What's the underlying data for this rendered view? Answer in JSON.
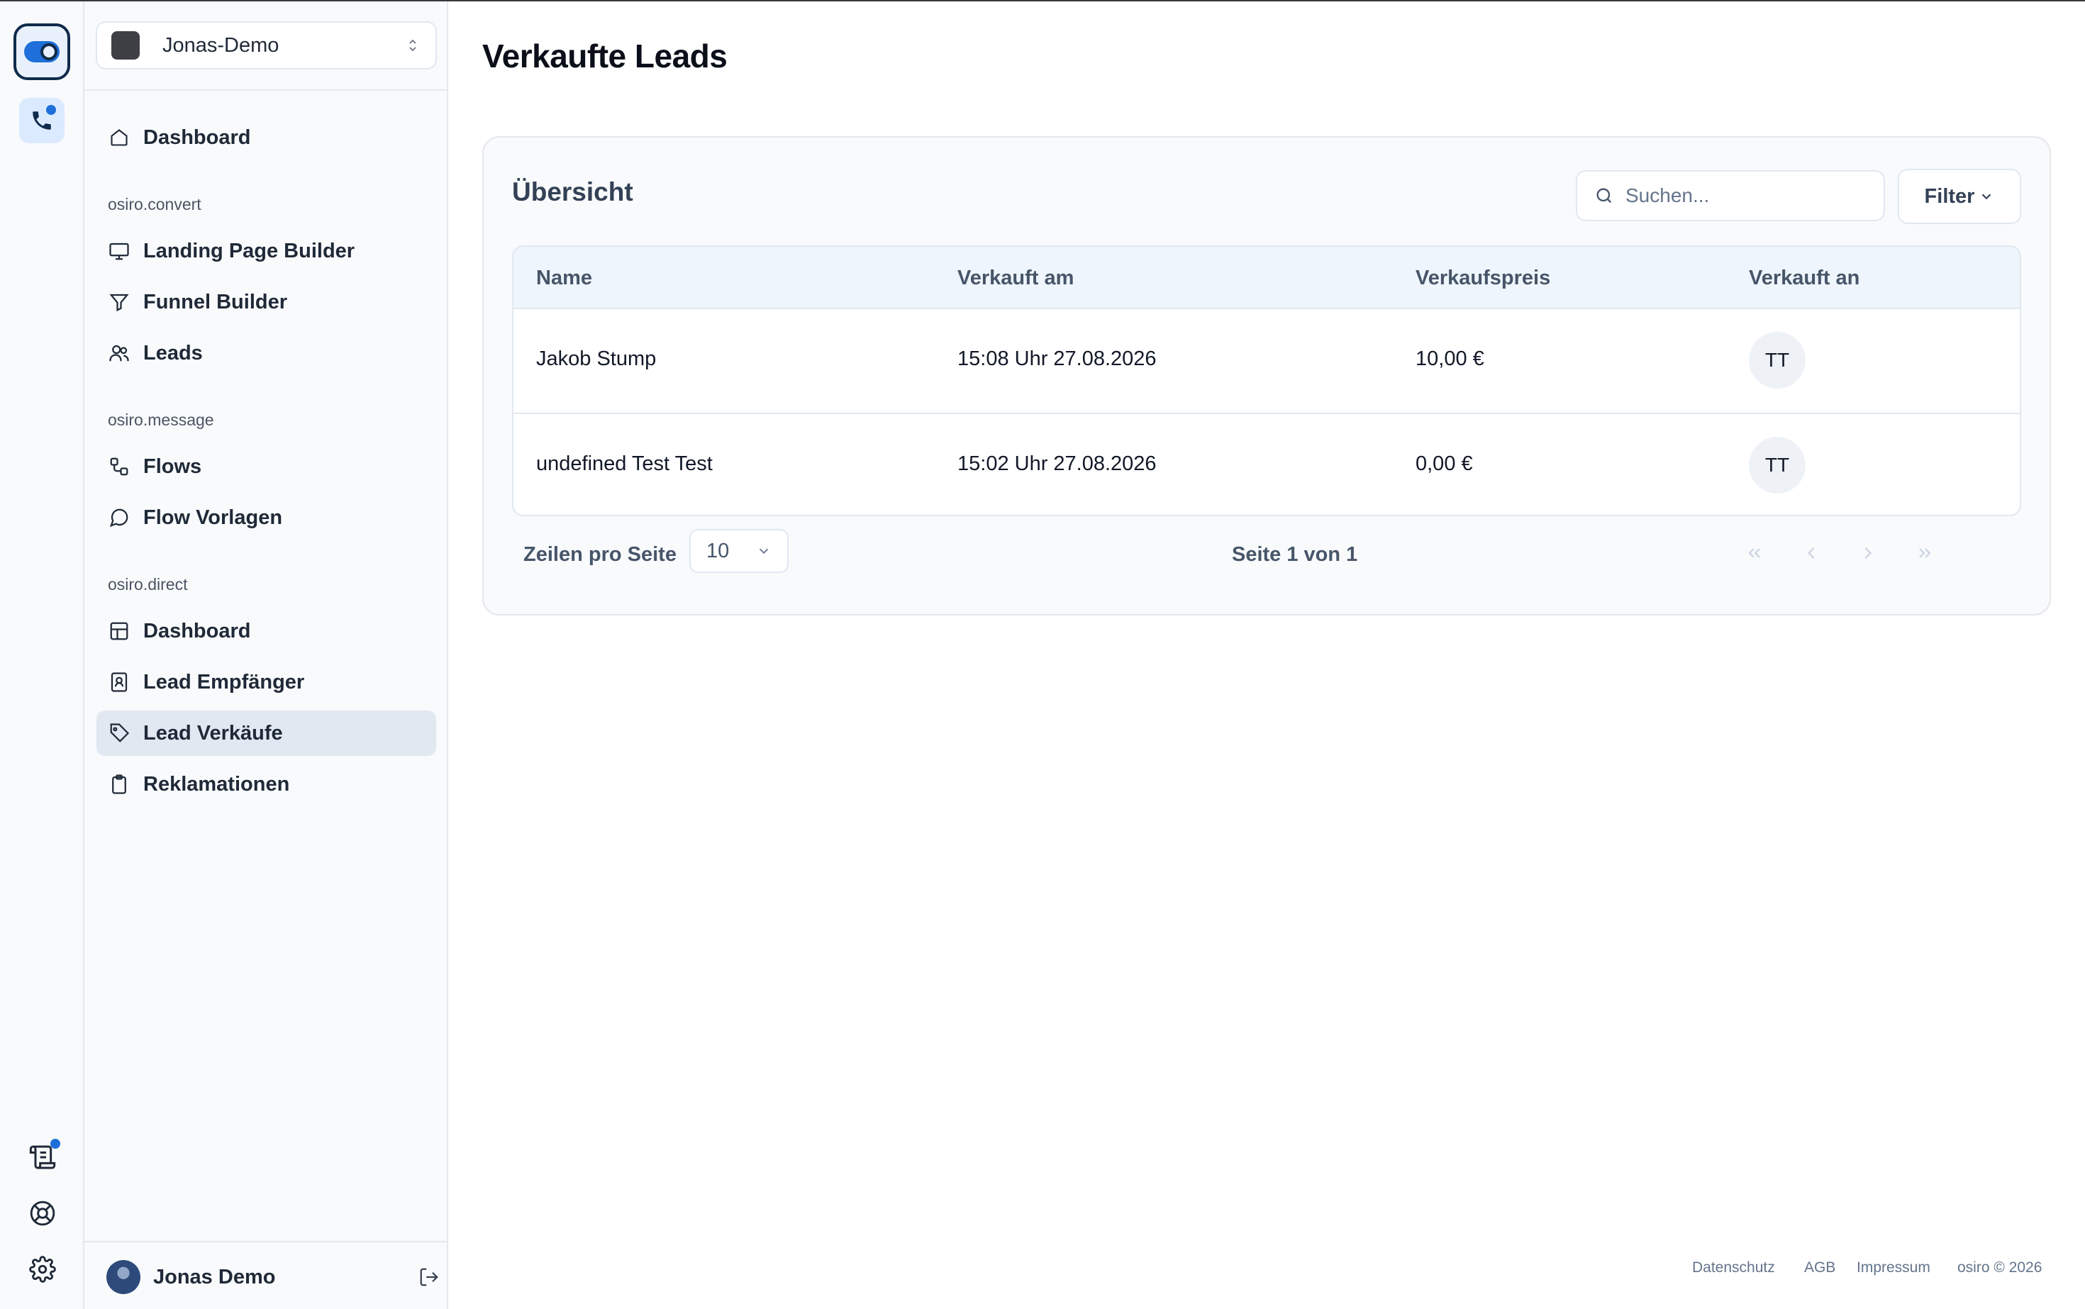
{
  "workspace": {
    "name": "Jonas-Demo"
  },
  "sidebar": {
    "top_item": "Dashboard",
    "sections": [
      {
        "title": "osiro.convert",
        "items": [
          "Landing Page Builder",
          "Funnel Builder",
          "Leads"
        ]
      },
      {
        "title": "osiro.message",
        "items": [
          "Flows",
          "Flow Vorlagen"
        ]
      },
      {
        "title": "osiro.direct",
        "items": [
          "Dashboard",
          "Lead Empfänger",
          "Lead Verkäufe",
          "Reklamationen"
        ]
      }
    ],
    "active_item": "Lead Verkäufe",
    "user": {
      "name": "Jonas Demo"
    }
  },
  "page": {
    "title": "Verkaufte Leads"
  },
  "card": {
    "title": "Übersicht",
    "search_placeholder": "Suchen...",
    "filter_label": "Filter"
  },
  "table": {
    "columns": [
      "Name",
      "Verkauft am",
      "Verkaufspreis",
      "Verkauft an"
    ],
    "rows": [
      {
        "name": "Jakob Stump",
        "sold_at": "15:08 Uhr 27.08.2026",
        "price": "10,00 €",
        "buyer": "TT"
      },
      {
        "name": "undefined Test Test",
        "sold_at": "15:02 Uhr 27.08.2026",
        "price": "0,00 €",
        "buyer": "TT"
      }
    ]
  },
  "pagination": {
    "rows_per_page_label": "Zeilen pro Seite",
    "rows_per_page": "10",
    "page_info": "Seite 1 von 1"
  },
  "footer": {
    "links": [
      "Datenschutz",
      "AGB",
      "Impressum",
      "osiro © 2026"
    ]
  },
  "colors": {
    "accent": "#1e6fd9",
    "active_bg": "#e1e8f2",
    "table_header_bg": "#eef5fc"
  }
}
